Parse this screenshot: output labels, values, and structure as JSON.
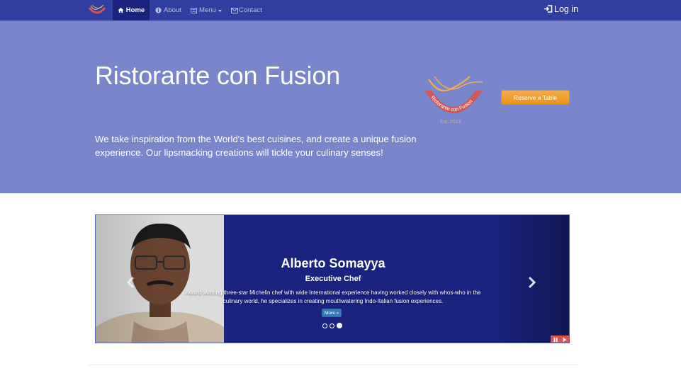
{
  "navbar": {
    "items": [
      {
        "label": "Home",
        "icon": "home-icon",
        "active": true
      },
      {
        "label": "About",
        "icon": "info-circle-icon",
        "active": false
      },
      {
        "label": "Menu",
        "icon": "list-icon",
        "active": false,
        "dropdown": true
      },
      {
        "label": "Contact",
        "icon": "envelope-icon",
        "active": false
      }
    ],
    "login_label": "Log in",
    "colors": {
      "bar": "#303f9f",
      "active": "#1a237e"
    }
  },
  "jumbotron": {
    "title": "Ristorante con Fusion",
    "text": "We take inspiration from the World's best cuisines, and create a unique fusion experience. Our lipsmacking creations will tickle your culinary senses!",
    "logo_text": "Ristorante con Fusion",
    "logo_est": "Est. 2013",
    "reserve_label": "Reserve a Table",
    "background": "#7986cb"
  },
  "carousel": {
    "name": "Alberto Somayya",
    "role": "Executive Chef",
    "description": "Award winning three-star Michelin chef with wide International experience having worked closely with whos-who in the culinary world, he specializes in creating mouthwatering Indo-Italian fusion experiences.",
    "more_label": "More »",
    "slide_count": 3,
    "active_slide": 3,
    "background": "#1a237e"
  }
}
